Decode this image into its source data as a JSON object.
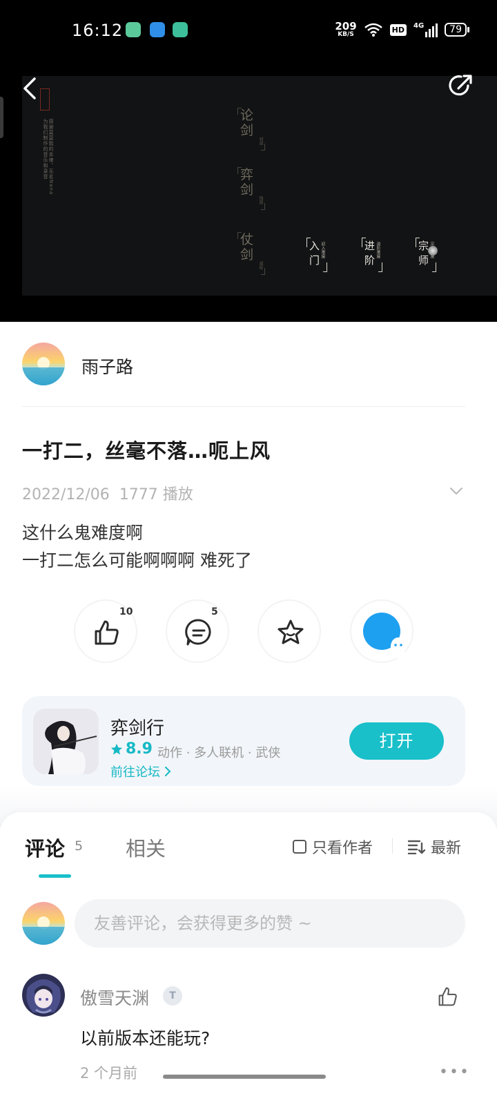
{
  "status_bar": {
    "time": "16:12",
    "net_speed": "209",
    "net_unit": "KB/S",
    "hd": "HD",
    "network": "4G",
    "battery": "79"
  },
  "video": {
    "menu": [
      {
        "char1": "论",
        "char2": "剑",
        "sub": "对战"
      },
      {
        "char1": "弈",
        "char2": "剑",
        "sub": "残局"
      },
      {
        "char1": "仗",
        "char2": "剑",
        "sub": "战役"
      }
    ],
    "levels": [
      {
        "char1": "入",
        "char2": "门",
        "sub": "初入难度"
      },
      {
        "char1": "进",
        "char2": "阶",
        "sub": "进阶难度"
      },
      {
        "char1": "宗",
        "char2": "师",
        "sub": "宗师难度"
      }
    ],
    "side_text_1": "感谢莫莫我的本律，无名Nana",
    "side_text_2": "为我们制作的音乐和录音"
  },
  "author": {
    "name": "雨子路"
  },
  "post": {
    "title": "一打二，丝毫不落…呃上风",
    "date": "2022/12/06",
    "plays": "1777 播放",
    "body_line1": "这什么鬼难度啊",
    "body_line2": "一打二怎么可能啊啊啊  难死了"
  },
  "actions": {
    "like_count": "10",
    "comment_count": "5"
  },
  "game": {
    "name": "弈剑行",
    "rating": "8.9",
    "tags": "动作 · 多人联机 · 武侠",
    "forum_link": "前往论坛",
    "open_label": "打开"
  },
  "comments": {
    "tab_comments": "评论",
    "tab_comments_count": "5",
    "tab_related": "相关",
    "only_author": "只看作者",
    "sort": "最新",
    "input_placeholder": "友善评论，会获得更多的赞 ~",
    "items": [
      {
        "name": "傲雪天渊",
        "badge": "T",
        "text": "以前版本还能玩?",
        "time": "2 个月前"
      }
    ]
  },
  "colors": {
    "accent": "#19bfc9",
    "qq_blue": "#1ea0f0",
    "video_bg": "#121314"
  }
}
